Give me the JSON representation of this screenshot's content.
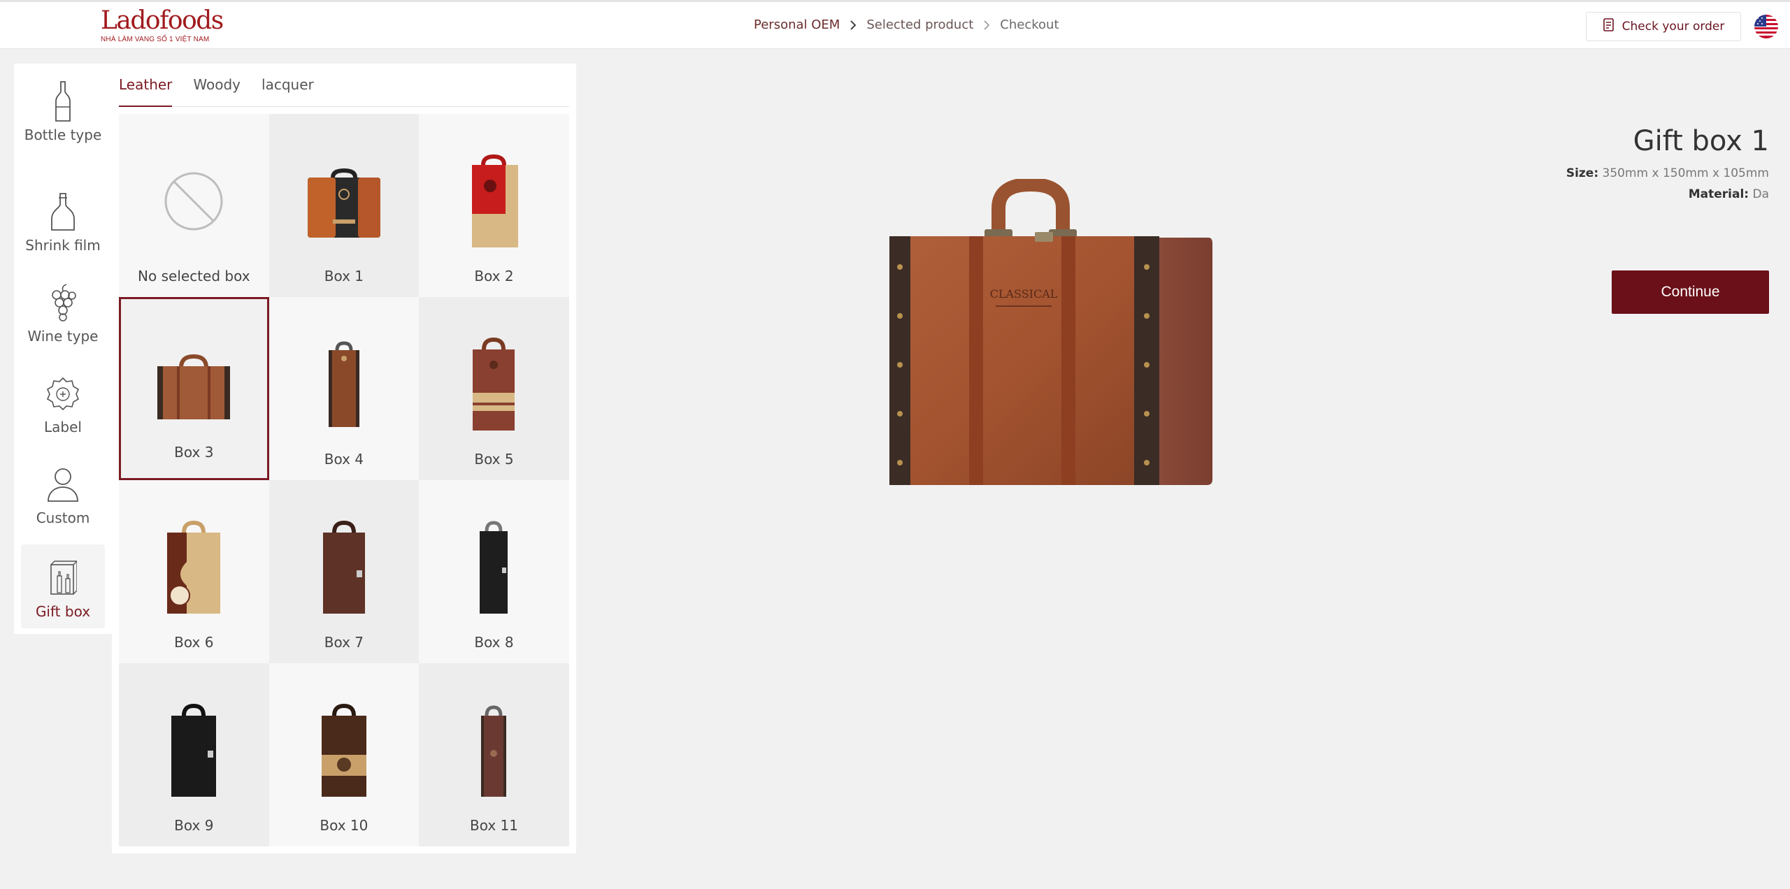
{
  "header": {
    "logo_text": "Ladofoods",
    "logo_tagline": "NHÀ LÀM VANG SỐ 1 VIỆT NAM",
    "breadcrumbs": [
      "Personal OEM",
      "Selected product",
      "Checkout"
    ],
    "check_order_label": "Check your order",
    "language_icon": "us-flag-icon"
  },
  "steps": [
    {
      "label": "Bottle type",
      "icon": "bottle-icon"
    },
    {
      "label": "Shrink film",
      "icon": "shrink-film-icon"
    },
    {
      "label": "Wine type",
      "icon": "grapes-icon"
    },
    {
      "label": "Label",
      "icon": "label-icon"
    },
    {
      "label": "Custom",
      "icon": "person-icon"
    },
    {
      "label": "Gift box",
      "icon": "gift-box-icon",
      "active": true
    }
  ],
  "catalog": {
    "tabs": [
      "Leather",
      "Woody",
      "lacquer"
    ],
    "active_tab": "Leather",
    "items": [
      {
        "label": "No selected box"
      },
      {
        "label": "Box 1"
      },
      {
        "label": "Box 2"
      },
      {
        "label": "Box 3",
        "selected": true
      },
      {
        "label": "Box 4"
      },
      {
        "label": "Box 5"
      },
      {
        "label": "Box 6"
      },
      {
        "label": "Box 7"
      },
      {
        "label": "Box 8"
      },
      {
        "label": "Box 9"
      },
      {
        "label": "Box 10"
      },
      {
        "label": "Box 11"
      }
    ]
  },
  "product": {
    "name": "Gift box 1",
    "size_label": "Size:",
    "size_value": "350mm x 150mm x 105mm",
    "material_label": "Material:",
    "material_value": "Da",
    "preview_stamp": "CLASSICAL",
    "continue_label": "Continue"
  },
  "colors": {
    "brand": "#a01a1e",
    "accent": "#7b1a22",
    "button": "#6b0f18"
  }
}
